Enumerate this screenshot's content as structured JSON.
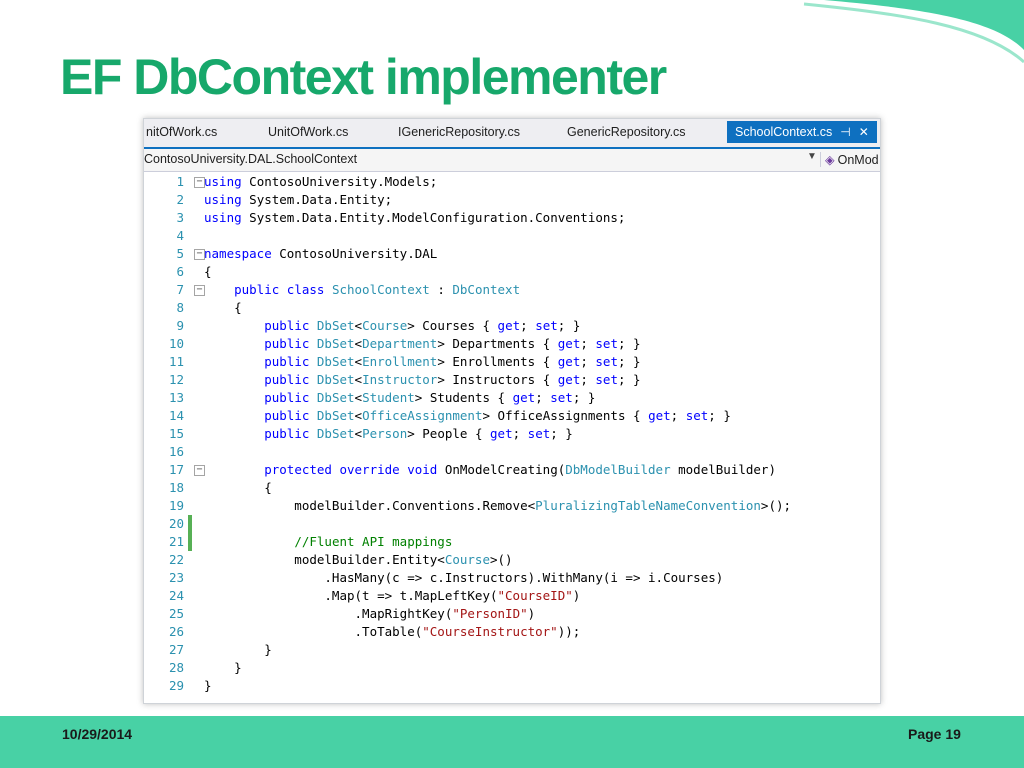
{
  "slide": {
    "title": "EF DbContext implementer",
    "footer_date": "10/29/2014",
    "footer_page": "Page 19",
    "accent_color": "#17a86b",
    "footer_color": "#48d1a5"
  },
  "editor": {
    "tabs": [
      {
        "label": "nitOfWork.cs",
        "active": false
      },
      {
        "label": "UnitOfWork.cs",
        "active": false
      },
      {
        "label": "IGenericRepository.cs",
        "active": false
      },
      {
        "label": "GenericRepository.cs",
        "active": false
      },
      {
        "label": "SchoolContext.cs",
        "active": true
      }
    ],
    "tab_icons": {
      "pin": "pin-icon",
      "close": "close-icon"
    },
    "navigation": {
      "class_selector": "ContosoUniversity.DAL.SchoolContext",
      "member_selector": "OnMod"
    },
    "lines": [
      {
        "n": "1",
        "fold": "⊟",
        "tokens": [
          [
            "k",
            "using"
          ],
          [
            "p",
            " ContosoUniversity.Models;"
          ]
        ]
      },
      {
        "n": "2",
        "tokens": [
          [
            "k",
            "using"
          ],
          [
            "p",
            " System.Data.Entity;"
          ]
        ]
      },
      {
        "n": "3",
        "tokens": [
          [
            "k",
            "using"
          ],
          [
            "p",
            " System.Data.Entity.ModelConfiguration.Conventions;"
          ]
        ]
      },
      {
        "n": "4",
        "tokens": []
      },
      {
        "n": "5",
        "fold": "⊟",
        "tokens": [
          [
            "k",
            "namespace"
          ],
          [
            "p",
            " ContosoUniversity.DAL"
          ]
        ]
      },
      {
        "n": "6",
        "tokens": [
          [
            "p",
            "{"
          ]
        ]
      },
      {
        "n": "7",
        "fold": "⊟",
        "tokens": [
          [
            "p",
            "    "
          ],
          [
            "k",
            "public class"
          ],
          [
            "p",
            " "
          ],
          [
            "t",
            "SchoolContext"
          ],
          [
            "p",
            " : "
          ],
          [
            "t",
            "DbContext"
          ]
        ]
      },
      {
        "n": "8",
        "tokens": [
          [
            "p",
            "    {"
          ]
        ]
      },
      {
        "n": "9",
        "tokens": [
          [
            "p",
            "        "
          ],
          [
            "k",
            "public"
          ],
          [
            "p",
            " "
          ],
          [
            "t",
            "DbSet"
          ],
          [
            "p",
            "<"
          ],
          [
            "t",
            "Course"
          ],
          [
            "p",
            "> Courses { "
          ],
          [
            "k",
            "get"
          ],
          [
            "p",
            "; "
          ],
          [
            "k",
            "set"
          ],
          [
            "p",
            "; }"
          ]
        ]
      },
      {
        "n": "10",
        "tokens": [
          [
            "p",
            "        "
          ],
          [
            "k",
            "public"
          ],
          [
            "p",
            " "
          ],
          [
            "t",
            "DbSet"
          ],
          [
            "p",
            "<"
          ],
          [
            "t",
            "Department"
          ],
          [
            "p",
            "> Departments { "
          ],
          [
            "k",
            "get"
          ],
          [
            "p",
            "; "
          ],
          [
            "k",
            "set"
          ],
          [
            "p",
            "; }"
          ]
        ]
      },
      {
        "n": "11",
        "tokens": [
          [
            "p",
            "        "
          ],
          [
            "k",
            "public"
          ],
          [
            "p",
            " "
          ],
          [
            "t",
            "DbSet"
          ],
          [
            "p",
            "<"
          ],
          [
            "t",
            "Enrollment"
          ],
          [
            "p",
            "> Enrollments { "
          ],
          [
            "k",
            "get"
          ],
          [
            "p",
            "; "
          ],
          [
            "k",
            "set"
          ],
          [
            "p",
            "; }"
          ]
        ]
      },
      {
        "n": "12",
        "tokens": [
          [
            "p",
            "        "
          ],
          [
            "k",
            "public"
          ],
          [
            "p",
            " "
          ],
          [
            "t",
            "DbSet"
          ],
          [
            "p",
            "<"
          ],
          [
            "t",
            "Instructor"
          ],
          [
            "p",
            "> Instructors { "
          ],
          [
            "k",
            "get"
          ],
          [
            "p",
            "; "
          ],
          [
            "k",
            "set"
          ],
          [
            "p",
            "; }"
          ]
        ]
      },
      {
        "n": "13",
        "tokens": [
          [
            "p",
            "        "
          ],
          [
            "k",
            "public"
          ],
          [
            "p",
            " "
          ],
          [
            "t",
            "DbSet"
          ],
          [
            "p",
            "<"
          ],
          [
            "t",
            "Student"
          ],
          [
            "p",
            "> Students { "
          ],
          [
            "k",
            "get"
          ],
          [
            "p",
            "; "
          ],
          [
            "k",
            "set"
          ],
          [
            "p",
            "; }"
          ]
        ]
      },
      {
        "n": "14",
        "tokens": [
          [
            "p",
            "        "
          ],
          [
            "k",
            "public"
          ],
          [
            "p",
            " "
          ],
          [
            "t",
            "DbSet"
          ],
          [
            "p",
            "<"
          ],
          [
            "t",
            "OfficeAssignment"
          ],
          [
            "p",
            "> OfficeAssignments { "
          ],
          [
            "k",
            "get"
          ],
          [
            "p",
            "; "
          ],
          [
            "k",
            "set"
          ],
          [
            "p",
            "; }"
          ]
        ]
      },
      {
        "n": "15",
        "tokens": [
          [
            "p",
            "        "
          ],
          [
            "k",
            "public"
          ],
          [
            "p",
            " "
          ],
          [
            "t",
            "DbSet"
          ],
          [
            "p",
            "<"
          ],
          [
            "t",
            "Person"
          ],
          [
            "p",
            "> People { "
          ],
          [
            "k",
            "get"
          ],
          [
            "p",
            "; "
          ],
          [
            "k",
            "set"
          ],
          [
            "p",
            "; }"
          ]
        ]
      },
      {
        "n": "16",
        "tokens": []
      },
      {
        "n": "17",
        "fold": "⊟",
        "tokens": [
          [
            "p",
            "        "
          ],
          [
            "k",
            "protected override void"
          ],
          [
            "p",
            " OnModelCreating("
          ],
          [
            "t",
            "DbModelBuilder"
          ],
          [
            "p",
            " modelBuilder)"
          ]
        ]
      },
      {
        "n": "18",
        "tokens": [
          [
            "p",
            "        {"
          ]
        ]
      },
      {
        "n": "19",
        "tokens": [
          [
            "p",
            "            modelBuilder.Conventions.Remove<"
          ],
          [
            "t",
            "PluralizingTableNameConvention"
          ],
          [
            "p",
            ">();"
          ]
        ]
      },
      {
        "n": "20",
        "changed": true,
        "tokens": []
      },
      {
        "n": "21",
        "changed": true,
        "tokens": [
          [
            "p",
            "            "
          ],
          [
            "c",
            "//Fluent API mappings"
          ]
        ]
      },
      {
        "n": "22",
        "tokens": [
          [
            "p",
            "            modelBuilder.Entity<"
          ],
          [
            "t",
            "Course"
          ],
          [
            "p",
            ">()"
          ]
        ]
      },
      {
        "n": "23",
        "tokens": [
          [
            "p",
            "                .HasMany(c => c.Instructors).WithMany(i => i.Courses)"
          ]
        ]
      },
      {
        "n": "24",
        "tokens": [
          [
            "p",
            "                .Map(t => t.MapLeftKey("
          ],
          [
            "s",
            "\"CourseID\""
          ],
          [
            "p",
            ")"
          ]
        ]
      },
      {
        "n": "25",
        "tokens": [
          [
            "p",
            "                    .MapRightKey("
          ],
          [
            "s",
            "\"PersonID\""
          ],
          [
            "p",
            ")"
          ]
        ]
      },
      {
        "n": "26",
        "tokens": [
          [
            "p",
            "                    .ToTable("
          ],
          [
            "s",
            "\"CourseInstructor\""
          ],
          [
            "p",
            "));"
          ]
        ]
      },
      {
        "n": "27",
        "tokens": [
          [
            "p",
            "        }"
          ]
        ]
      },
      {
        "n": "28",
        "tokens": [
          [
            "p",
            "    }"
          ]
        ]
      },
      {
        "n": "29",
        "tokens": [
          [
            "p",
            "}"
          ]
        ]
      }
    ]
  }
}
